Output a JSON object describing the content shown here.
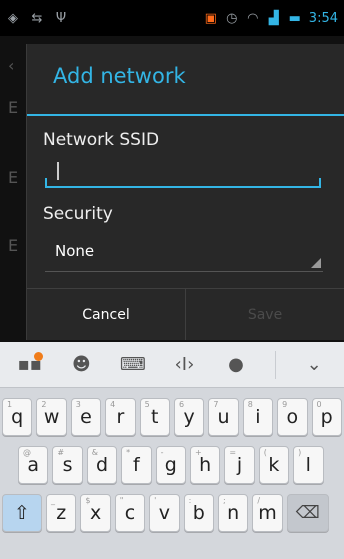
{
  "status_bar": {
    "time": "3:54",
    "icons": [
      "signal-dots-icon",
      "usb-icon",
      "sync-icon",
      "sim-icon",
      "alarm-icon",
      "wifi-icon",
      "signal-icon",
      "signal2-icon",
      "battery-icon"
    ]
  },
  "dialog": {
    "title": "Add network",
    "ssid_label": "Network SSID",
    "ssid_value": "",
    "security_label": "Security",
    "security_value": "None",
    "cancel_label": "Cancel",
    "save_label": "Save"
  },
  "keyboard": {
    "row1": [
      {
        "k": "q",
        "h": "1"
      },
      {
        "k": "w",
        "h": "2"
      },
      {
        "k": "e",
        "h": "3"
      },
      {
        "k": "r",
        "h": "4"
      },
      {
        "k": "t",
        "h": "5"
      },
      {
        "k": "y",
        "h": "6"
      },
      {
        "k": "u",
        "h": "7"
      },
      {
        "k": "i",
        "h": "8"
      },
      {
        "k": "o",
        "h": "9"
      },
      {
        "k": "p",
        "h": "0"
      }
    ],
    "row2": [
      {
        "k": "a",
        "h": "@"
      },
      {
        "k": "s",
        "h": "#"
      },
      {
        "k": "d",
        "h": "&"
      },
      {
        "k": "f",
        "h": "*"
      },
      {
        "k": "g",
        "h": "-"
      },
      {
        "k": "h",
        "h": "+"
      },
      {
        "k": "j",
        "h": "="
      },
      {
        "k": "k",
        "h": "("
      },
      {
        "k": "l",
        "h": ")"
      }
    ],
    "row3": [
      {
        "k": "z",
        "h": "_"
      },
      {
        "k": "x",
        "h": "$"
      },
      {
        "k": "c",
        "h": "\""
      },
      {
        "k": "v",
        "h": "'"
      },
      {
        "k": "b",
        "h": ":"
      },
      {
        "k": "n",
        "h": ";"
      },
      {
        "k": "m",
        "h": "/"
      }
    ]
  }
}
